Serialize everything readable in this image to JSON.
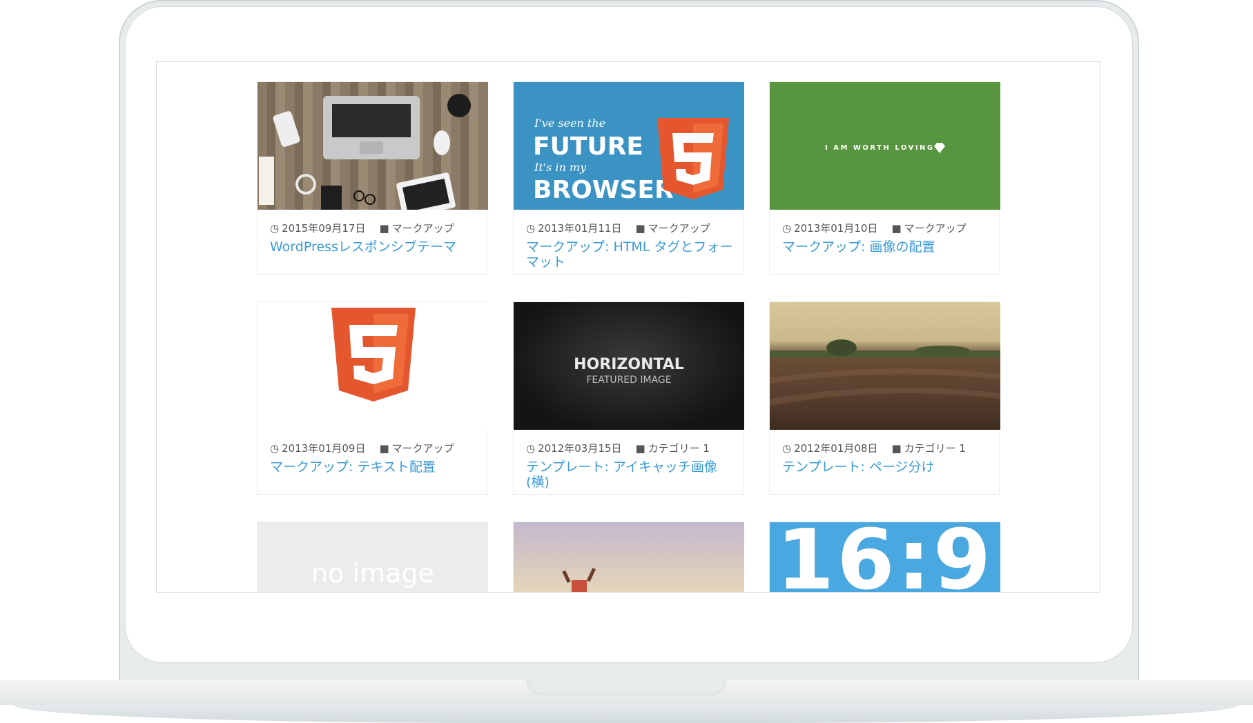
{
  "colors": {
    "title_link": "#3a9ad6",
    "meta_text": "#555555"
  },
  "posts": [
    {
      "date": "2015年09月17日",
      "category": "マークアップ",
      "title": "WordPressレスポンシブテーマ"
    },
    {
      "date": "2013年01月11日",
      "category": "マークアップ",
      "title": "マークアップ: HTML タグとフォーマット",
      "thumb_text": {
        "l1": "I've seen the",
        "l2": "FUTURE",
        "l3": "It's in my",
        "l4": "BROWSER"
      }
    },
    {
      "date": "2013年01月10日",
      "category": "マークアップ",
      "title": "マークアップ: 画像の配置",
      "thumb_text": {
        "l1": "I AM WORTH LOVING"
      }
    },
    {
      "date": "2013年01月09日",
      "category": "マークアップ",
      "title": "マークアップ: テキスト配置"
    },
    {
      "date": "2012年03月15日",
      "category": "カテゴリー 1",
      "title": "テンプレート: アイキャッチ画像 (横)",
      "thumb_text": {
        "l1": "HORIZONTAL",
        "l2": "FEATURED IMAGE"
      }
    },
    {
      "date": "2012年01月08日",
      "category": "カテゴリー 1",
      "title": "テンプレート: ページ分け"
    }
  ],
  "partial": [
    {
      "thumb_text": "no image"
    },
    {
      "thumb_text": ""
    },
    {
      "thumb_text": "16:9"
    }
  ],
  "icons": {
    "clock": "clock-icon",
    "folder": "folder-icon"
  }
}
